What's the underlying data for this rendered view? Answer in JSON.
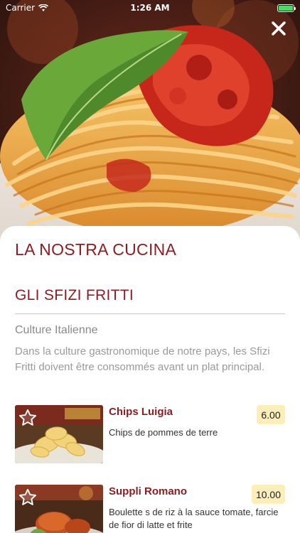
{
  "status_bar": {
    "carrier": "Carrier",
    "time": "1:26 AM",
    "battery_level": 1.0,
    "battery_color": "#4cd964"
  },
  "icons": {
    "close": "close-icon",
    "favorite": "star-outline-icon",
    "wifi": "wifi-icon",
    "battery": "battery-icon"
  },
  "hero": {
    "image": "spaghetti-tomato-basil-photo"
  },
  "sheet": {
    "title": "LA NOSTRA CUCINA",
    "section_title": "GLI SFIZI FRITTI",
    "culture_title": "Culture Italienne",
    "culture_description": "Dans la culture gastronomique de notre pays, les Sfizi Fritti doivent être consommés avant un plat principal."
  },
  "menu_items": [
    {
      "name": "Chips Luigia",
      "description": "Chips de pommes de terre",
      "price": "6.00",
      "image": "potato-chips-photo"
    },
    {
      "name": "Suppli Romano",
      "description": "Boulette s de riz à la sauce tomate, farcie de fior di latte et frite",
      "price": "10.00",
      "image": "fried-rice-balls-photo"
    }
  ],
  "colors": {
    "accent": "#8e1b1f",
    "price_badge": "#fbeebb",
    "muted_text": "#9a9a9a"
  }
}
